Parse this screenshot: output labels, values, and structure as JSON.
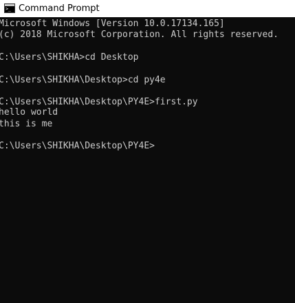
{
  "window": {
    "title": "Command Prompt",
    "icon": "cmd-icon",
    "icon_text": ">_"
  },
  "console": {
    "foreground": "#cccccc",
    "background": "#0c0c0c",
    "lines": [
      "Microsoft Windows [Version 10.0.17134.165]",
      "(c) 2018 Microsoft Corporation. All rights reserved.",
      "C:\\Users\\SHIKHA>cd Desktop",
      "C:\\Users\\SHIKHA\\Desktop>cd py4e",
      "C:\\Users\\SHIKHA\\Desktop\\PY4E>first.py",
      "hello world",
      "this is me",
      "C:\\Users\\SHIKHA\\Desktop\\PY4E>"
    ]
  }
}
